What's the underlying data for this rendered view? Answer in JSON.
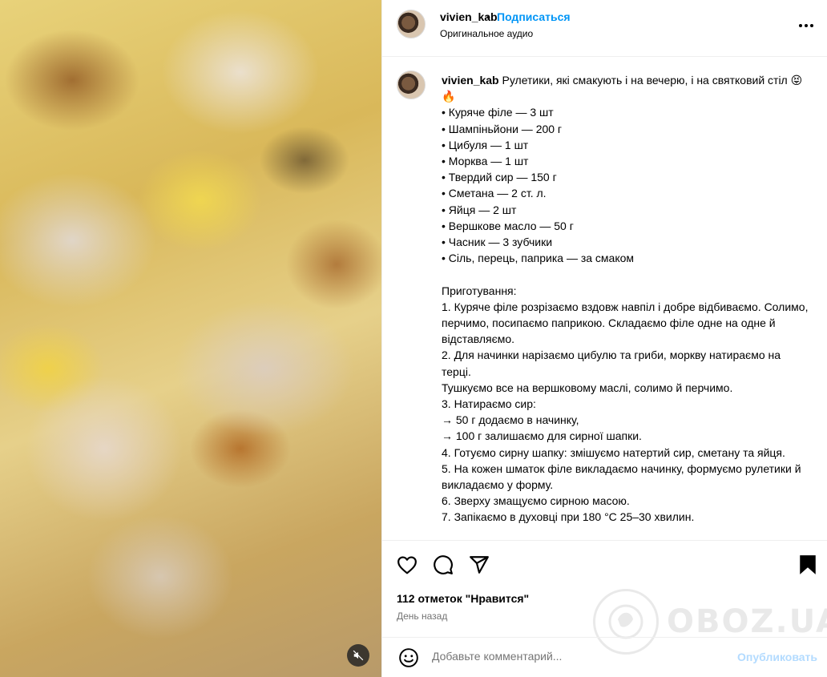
{
  "header": {
    "username": "vivien_kab",
    "separator": "•",
    "follow_label": "Подписаться",
    "audio_label": "Оригинальное аудио"
  },
  "caption": {
    "username": "vivien_kab",
    "lines": [
      "Рулетики, які смакують і на вечерю, і на святковий стіл 😝🔥",
      "• Куряче філе — 3 шт",
      "• Шампіньйони — 200 г",
      "• Цибуля — 1 шт",
      "• Морква — 1 шт",
      "• Твердий сир — 150 г",
      "• Сметана — 2 ст. л.",
      "• Яйця — 2 шт",
      "• Вершкове масло — 50 г",
      "• Часник — 3 зубчики",
      "• Сіль, перець, паприка — за смаком",
      "",
      "Приготування:",
      "1. Куряче філе розрізаємо вздовж навпіл і добре відбиваємо. Солимо, перчимо, посипаємо паприкою. Складаємо філе одне на одне й відставляємо.",
      "2. Для начинки нарізаємо цибулю та гриби, моркву натираємо на терці.",
      "Тушкуємо все на вершковому маслі, солимо й перчимо.",
      "3. Натираємо сир:",
      "→ 50 г додаємо в начинку,",
      "→ 100 г залишаємо для сирної шапки.",
      "4. Готуємо сирну шапку: змішуємо натертий сир, сметану та яйця.",
      "5. На кожен шматок філе викладаємо начинку, формуємо рулетики й викладаємо у форму.",
      "6. Зверху змащуємо сирною масою.",
      "7. Запікаємо в духовці при 180 °С 25–30 хвилин."
    ]
  },
  "actions": {
    "like_icon": "heart-icon",
    "comment_icon": "comment-icon",
    "share_icon": "share-icon",
    "save_icon": "bookmark-icon",
    "likes_text": "112 отметок \"Нравится\"",
    "time_text": "День назад"
  },
  "comment": {
    "emoji_icon": "emoji-icon",
    "placeholder": "Добавьте комментарий...",
    "post_label": "Опубликовать"
  },
  "media": {
    "mute_icon": "sound-off-icon"
  },
  "watermark": {
    "text": "OBOZ.UA"
  },
  "colors": {
    "accent": "#0095f6",
    "post_disabled": "#b3dbff",
    "secondary_text": "#737373",
    "border": "#efefef"
  }
}
